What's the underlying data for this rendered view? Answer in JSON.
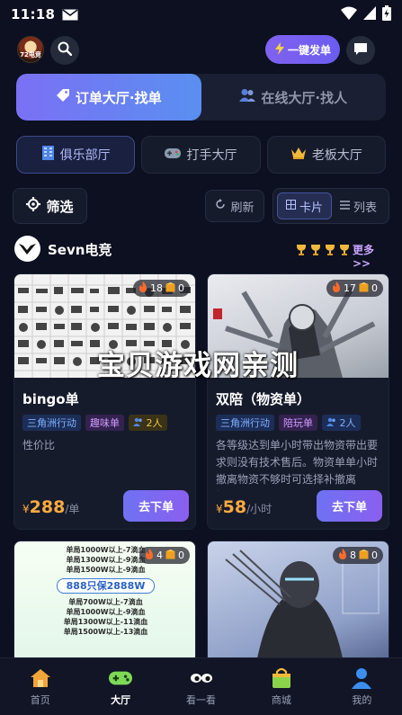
{
  "status_bar": {
    "time": "11:18"
  },
  "top_bar": {
    "avatar_text": "72电竞",
    "quick_order_label": "一键发单"
  },
  "main_tabs": [
    {
      "label": "订单大厅·找单",
      "active": true
    },
    {
      "label": "在线大厅·找人",
      "active": false
    }
  ],
  "sub_tabs": [
    {
      "label": "俱乐部厅",
      "active": true
    },
    {
      "label": "打手大厅",
      "active": false
    },
    {
      "label": "老板大厅",
      "active": false
    }
  ],
  "filter": {
    "filter_label": "筛选",
    "refresh_label": "刷新",
    "view_card_label": "卡片",
    "view_list_label": "列表"
  },
  "club": {
    "name": "Sevn电竞",
    "more_label": "更多>>",
    "trophy_count": 4
  },
  "cards": [
    {
      "title": "bingo单",
      "fire": "18",
      "box": "0",
      "tags": [
        "三角洲行动",
        "趣味单",
        "2人"
      ],
      "desc": "性价比",
      "price_symbol": "¥",
      "price": "288",
      "unit": "/单",
      "button": "去下单"
    },
    {
      "title": "双陪（物资单）",
      "fire": "17",
      "box": "0",
      "tags": [
        "三角洲行动",
        "陪玩单",
        "2人"
      ],
      "desc": "各等级达到单小时带出物资带出要求则没有技术售后。物资单单小时撤离物资不够时可选择补撤离 板…",
      "price_symbol": "¥",
      "price": "58",
      "unit": "/小时",
      "button": "去下单"
    },
    {
      "fire": "4",
      "box": "0",
      "lines": [
        "单局1000W以上-7滴血",
        "单局1300W以上-9滴血",
        "单局1500W以上-9滴血",
        "888只保2888W",
        "单局700W以上-7滴血",
        "单局1000W以上-9滴血",
        "单局1300W以上-11滴血",
        "单局1500W以上-13滴血"
      ]
    },
    {
      "fire": "8",
      "box": "0"
    }
  ],
  "watermark": "宝贝游戏网亲测",
  "bottom_nav": [
    {
      "label": "首页",
      "active": false
    },
    {
      "label": "大厅",
      "active": true
    },
    {
      "label": "看一看",
      "active": false
    },
    {
      "label": "商城",
      "active": false
    },
    {
      "label": "我的",
      "active": false
    }
  ],
  "colors": {
    "accent": "#7b70f5",
    "price": "#ffab3e",
    "bg": "#0c1020"
  }
}
